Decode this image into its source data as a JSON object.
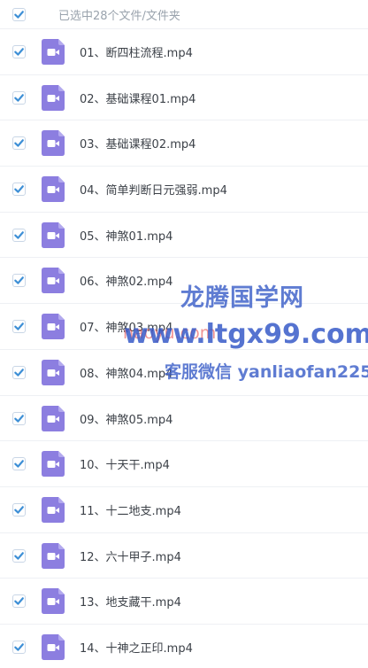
{
  "header": {
    "selection_text": "已选中28个文件/文件夹"
  },
  "files": [
    {
      "name": "01、断四柱流程.mp4",
      "checked": true
    },
    {
      "name": "02、基础课程01.mp4",
      "checked": true
    },
    {
      "name": "03、基础课程02.mp4",
      "checked": true
    },
    {
      "name": "04、简单判断日元强弱.mp4",
      "checked": true
    },
    {
      "name": "05、神煞01.mp4",
      "checked": true
    },
    {
      "name": "06、神煞02.mp4",
      "checked": true
    },
    {
      "name": "07、神煞03.mp4",
      "checked": true
    },
    {
      "name": "08、神煞04.mp4",
      "checked": true
    },
    {
      "name": "09、神煞05.mp4",
      "checked": true
    },
    {
      "name": "10、十天干.mp4",
      "checked": true
    },
    {
      "name": "11、十二地支.mp4",
      "checked": true
    },
    {
      "name": "12、六十甲子.mp4",
      "checked": true
    },
    {
      "name": "13、地支藏干.mp4",
      "checked": true
    },
    {
      "name": "14、十神之正印.mp4",
      "checked": true
    }
  ],
  "watermark": {
    "title": "龙腾国学网",
    "url": "www.ltgx99.com",
    "url_ghost": "naoyu.com",
    "service": "客服微信 yanliaofan225"
  },
  "colors": {
    "checkbox_check": "#3d8fd6",
    "video_icon": "#8c7ee0",
    "divider": "#eef0f4"
  },
  "icons": {
    "checkbox": "checkmark-icon",
    "file": "video-file-icon"
  }
}
